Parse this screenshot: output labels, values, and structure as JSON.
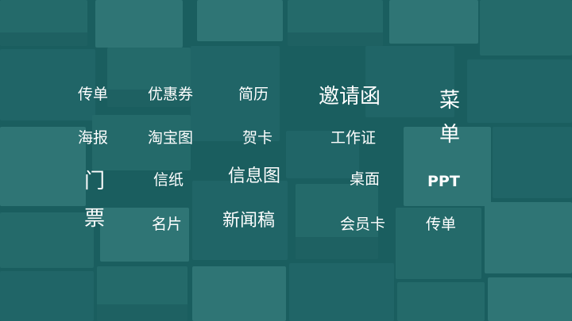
{
  "labels": {
    "leaflet": "传单",
    "coupon": "优惠券",
    "resume": "简历",
    "invitation": "邀请函",
    "menu_top": "菜",
    "poster": "海报",
    "taobao_image": "淘宝图",
    "greeting_card": "贺卡",
    "work_badge": "工作证",
    "menu_bottom": "单",
    "door_top": "门",
    "letter_paper": "信纸",
    "infographic": "信息图",
    "desktop": "桌面",
    "ppt": "PPT",
    "door_bottom": "票",
    "business_card": "名片",
    "press_release": "新闻稿",
    "member_card": "会员卡",
    "leaflet_2": "传单"
  },
  "background": {
    "overlay_color": "#1f5f60",
    "card_colors": [
      "#3c8482",
      "#2e6f71",
      "#4f9390",
      "#357a79"
    ]
  }
}
